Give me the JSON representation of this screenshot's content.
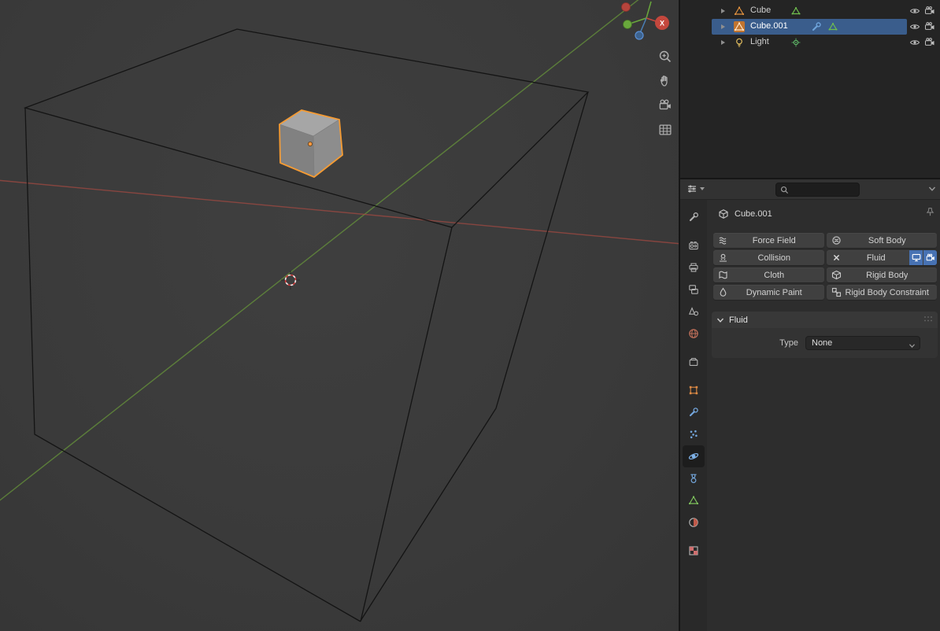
{
  "viewport": {
    "gizmo_axis_label": "X"
  },
  "outliner": {
    "rows": [
      {
        "name": "Cube",
        "type": "mesh",
        "selected": false
      },
      {
        "name": "Cube.001",
        "type": "mesh",
        "selected": true
      },
      {
        "name": "Light",
        "type": "light",
        "selected": false
      }
    ]
  },
  "properties": {
    "search": {
      "value": "",
      "placeholder": ""
    },
    "active_object": "Cube.001",
    "physics_buttons": [
      {
        "label": "Force Field"
      },
      {
        "label": "Soft Body"
      },
      {
        "label": "Collision"
      },
      {
        "label": "Fluid",
        "enabled": true
      },
      {
        "label": "Cloth"
      },
      {
        "label": "Rigid Body"
      },
      {
        "label": "Dynamic Paint"
      },
      {
        "label": "Rigid Body Constraint"
      }
    ],
    "fluid_panel": {
      "title": "Fluid",
      "type_label": "Type",
      "type_value": "None"
    }
  },
  "colors": {
    "selection_highlight": "#3a5d8c",
    "accent_blue": "#4772b3",
    "active_outline_orange": "#f59b33",
    "axis_x_red": "#a84a42",
    "axis_y_green": "#6a9b3a"
  },
  "icons": {
    "search-icon": "magnifier",
    "zoom-icon": "magnifier-plus",
    "pan-hand-icon": "hand",
    "camera-view-icon": "movie-camera",
    "grid-ortho-icon": "grid",
    "eye-icon": "eye",
    "render-visibility-camera-icon": "camera",
    "mesh-object-icon": "triangle-with-vertices",
    "modifier-wrench-icon": "wrench",
    "mesh-data-icon": "green-triangle",
    "light-icon": "bulb",
    "light-data-icon": "point-with-rays",
    "pin-icon": "pushpin",
    "remove-x-icon": "x-cross",
    "monitor-toggle-icon": "monitor",
    "camera-toggle-icon": "camera",
    "dropdown-chevron-icon": "chevron-down",
    "panel-grip-icon": "dot-grid",
    "expand-arrow-icon": "triangle-right"
  }
}
